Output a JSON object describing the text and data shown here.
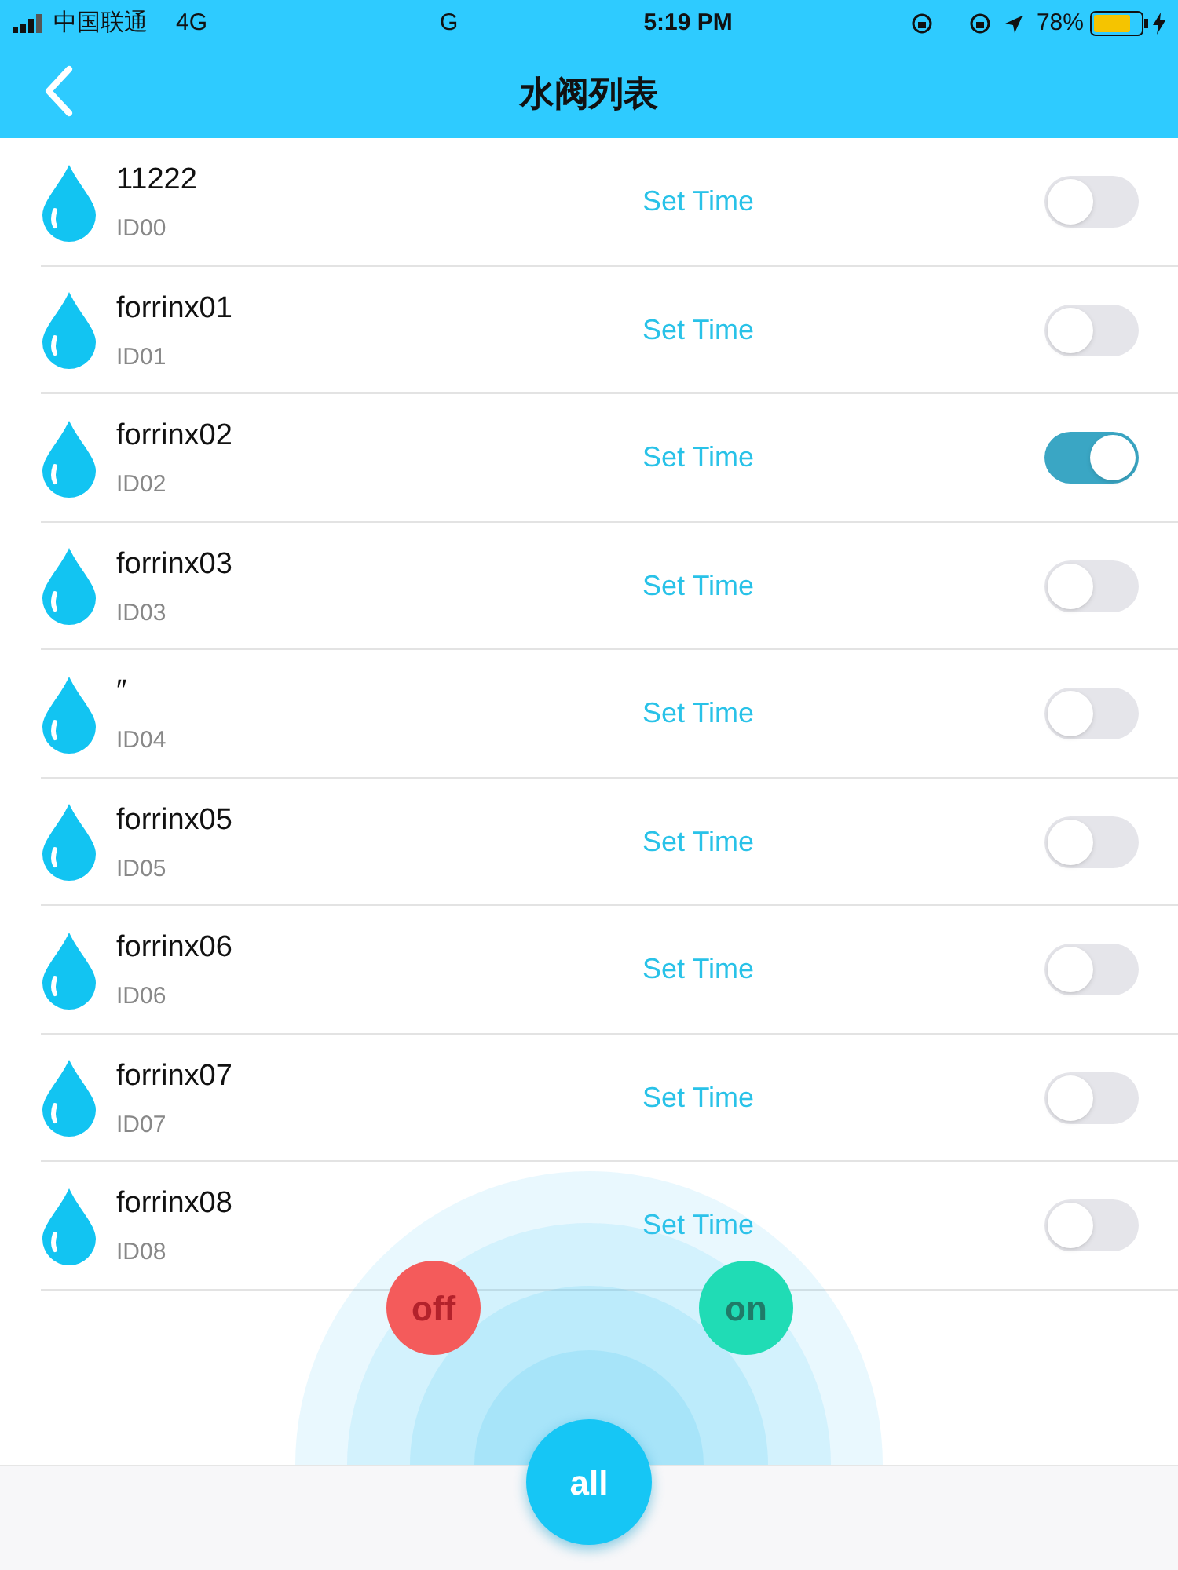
{
  "status_bar": {
    "carrier": "中国联通",
    "network": "4G",
    "network_2": "G",
    "time": "5:19 PM",
    "battery": "78%"
  },
  "nav": {
    "title": "水阀列表"
  },
  "valves": [
    {
      "name": "11222",
      "id": "ID00",
      "action": "Set Time",
      "on": false
    },
    {
      "name": "forrinx01",
      "id": "ID01",
      "action": "Set Time",
      "on": false
    },
    {
      "name": "forrinx02",
      "id": "ID02",
      "action": "Set Time",
      "on": true
    },
    {
      "name": "forrinx03",
      "id": "ID03",
      "action": "Set Time",
      "on": false
    },
    {
      "name": "″",
      "id": "ID04",
      "action": "Set Time",
      "on": false
    },
    {
      "name": "forrinx05",
      "id": "ID05",
      "action": "Set Time",
      "on": false
    },
    {
      "name": "forrinx06",
      "id": "ID06",
      "action": "Set Time",
      "on": false
    },
    {
      "name": "forrinx07",
      "id": "ID07",
      "action": "Set Time",
      "on": false
    },
    {
      "name": "forrinx08",
      "id": "ID08",
      "action": "Set Time",
      "on": false
    }
  ],
  "controls": {
    "off": "off",
    "on": "on",
    "all": "all"
  }
}
